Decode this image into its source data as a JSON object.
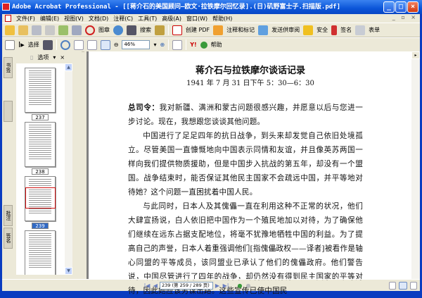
{
  "window": {
    "title": "Adobe Acrobat Professional - [[蒋介石的美国顾问—欧文·拉铁摩尔回忆录].(日)矶野富士子.扫描版.pdf]"
  },
  "menu": [
    "文件(F)",
    "编辑(E)",
    "视图(V)",
    "文档(D)",
    "注释(C)",
    "工具(T)",
    "高级(A)",
    "窗口(W)",
    "帮助(H)"
  ],
  "toolbar1": {
    "stamp": "图章",
    "search": "搜索",
    "create_pdf": "创建 PDF",
    "comment": "注释和标记",
    "review": "发送供审阅",
    "secure": "安全",
    "sign": "签名",
    "forms": "表单"
  },
  "toolbar2": {
    "select": "选择",
    "zoom": "46%",
    "help": "帮助"
  },
  "sidebar": {
    "options": "选项",
    "close": "×",
    "tabs": [
      "书签",
      "批注",
      "签名"
    ],
    "pages": [
      "237",
      "238",
      "239"
    ],
    "selected_page": "239"
  },
  "document": {
    "title": "蒋介石与拉铁摩尔谈话记录",
    "date": "1941 年 7 月 31 日下午 5：30—6：30",
    "speaker": "总司令：",
    "p1": "我对新疆、满洲和蒙古问题很感兴趣，并愿意以后与您进一步讨论。现在，我想跟您谈谈其他问题。",
    "p2": "中国进行了足足四年的抗日战争，到头来却发觉自己依旧处境孤立。尽管美国一直慷慨地向中国表示同情和友谊，并且像英苏两国一样向我们提供物质援助，但是中国步入抗战的第五年，却没有一个盟国。战争结束时，能否保证其他民主国家不会疏远中国，并平等地对待她？这个问题一直困扰着中国人民。",
    "p3": "与此同时，日本人及其傀儡一直在利用这种不正常的状况，他们大肆宣扬说，白人依旧把中国作为一个殖民地加以对待，为了确保他们继续在远东占据支配地位，将毫不犹豫地牺牲中国的利益。为了提高自己的声誉，日本人着重强调他们[指傀儡政权——译者]被看作是轴心同盟的平等成员，该同盟业已承认了他们的傀儡政府。他们警告说，中国尽管进行了四年的战争，却仍然没有得到民主国家的平等对待，因此她应该另谋出路。这些宣传已使中国民"
  },
  "status": {
    "page_field": "239 (第 259 / 289 页)"
  }
}
